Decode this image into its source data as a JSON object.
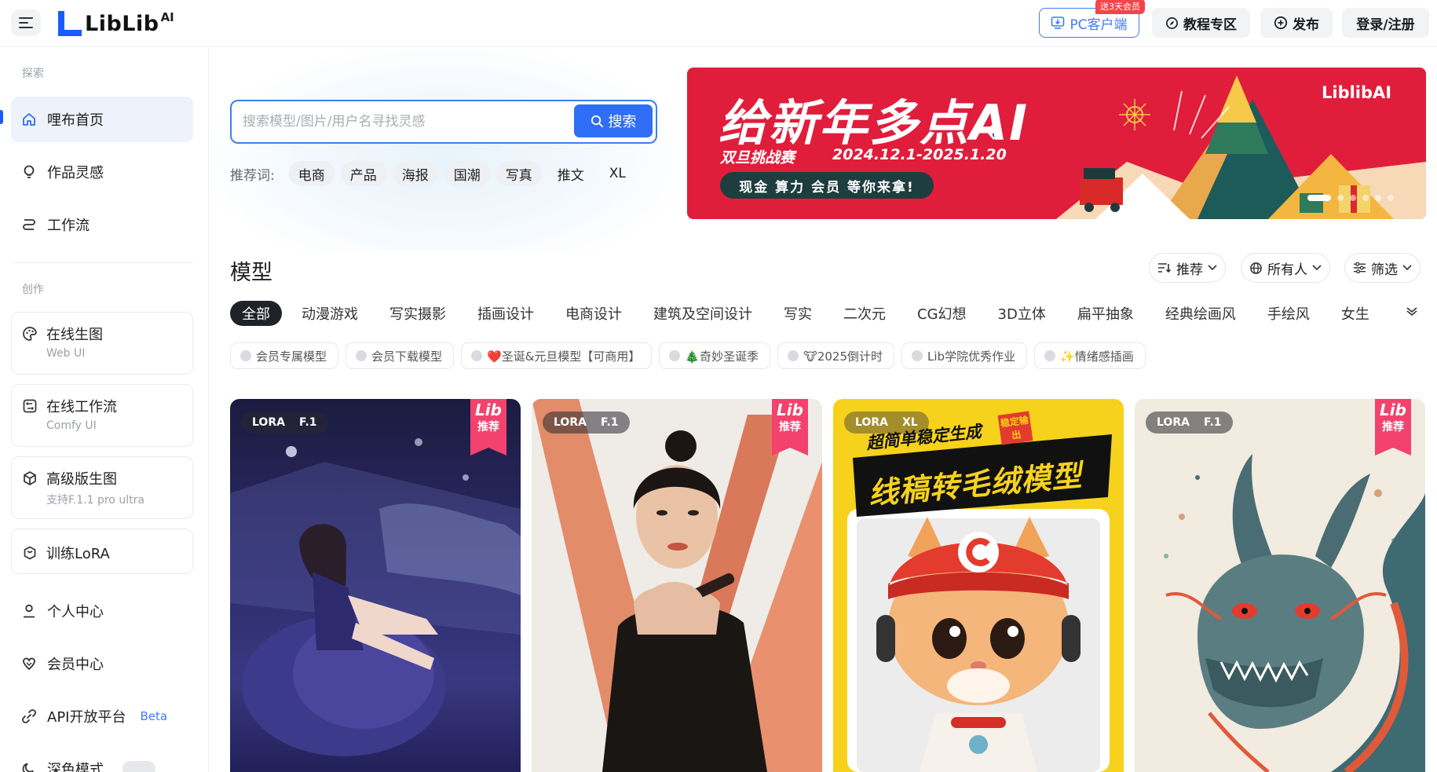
{
  "header": {
    "logo_text": "LiblibAI",
    "pc_client_label": "PC客户端",
    "pc_promo_tag": "送3天会员",
    "tutorial_label": "教程专区",
    "publish_label": "发布",
    "login_label": "登录/注册"
  },
  "sidebar": {
    "section_explore": "探索",
    "section_create": "创作",
    "items": [
      {
        "label": "哩布首页",
        "icon": "home-icon"
      },
      {
        "label": "作品灵感",
        "icon": "bulb-icon"
      },
      {
        "label": "工作流",
        "icon": "workflow-icon"
      }
    ],
    "create_items": [
      {
        "label": "在线生图",
        "sub": "Web UI",
        "icon": "palette-icon"
      },
      {
        "label": "在线工作流",
        "sub": "Comfy UI",
        "icon": "nodes-icon"
      },
      {
        "label": "高级版生图",
        "sub": "支持F.1.1 pro ultra",
        "icon": "cube-icon"
      },
      {
        "label": "训练LoRA",
        "sub": "",
        "icon": "box-icon"
      }
    ],
    "bottom_items": [
      {
        "label": "个人中心",
        "icon": "user-icon"
      },
      {
        "label": "会员中心",
        "icon": "diamond-icon"
      },
      {
        "label": "API开放平台",
        "badge": "Beta",
        "icon": "api-icon"
      },
      {
        "label": "深色模式",
        "icon": "moon-icon"
      }
    ]
  },
  "search": {
    "placeholder": "搜索模型/图片/用户名寻找灵感",
    "button_label": "搜索",
    "recommend_label": "推荐词:",
    "recommend_tags": [
      "电商",
      "产品",
      "海报",
      "国潮",
      "写真",
      "推文",
      "XL"
    ]
  },
  "banner": {
    "title": "给新年多点AI",
    "subtitle": "双旦挑战赛",
    "date": "2024.12.1-2025.1.20",
    "pill": "现金 算力 会员 等你来拿!",
    "logo": "LiblibAI"
  },
  "models": {
    "title": "模型",
    "sort_label": "推荐",
    "scope_label": "所有人",
    "filter_label": "筛选",
    "categories": [
      "全部",
      "动漫游戏",
      "写实摄影",
      "插画设计",
      "电商设计",
      "建筑及空间设计",
      "写实",
      "二次元",
      "CG幻想",
      "3D立体",
      "扁平抽象",
      "经典绘画风",
      "手绘风",
      "女生"
    ],
    "tags": [
      "会员专属模型",
      "会员下载模型",
      "❤️圣诞&元旦模型【可商用】",
      "🎄奇妙圣诞季",
      "🐮2025倒计时",
      "Lib学院优秀作业",
      "✨情绪感插画"
    ]
  },
  "cards": [
    {
      "type": "LORA",
      "base": "F.1",
      "ribbon_top": "Lib",
      "ribbon_bottom": "推荐"
    },
    {
      "type": "LORA",
      "base": "F.1",
      "ribbon_top": "Lib",
      "ribbon_bottom": "推荐"
    },
    {
      "type": "LORA",
      "base": "XL",
      "headline_small": "超简单稳定生成",
      "headline_big": "线稿转毛绒模型",
      "stamp": "稳定输出"
    },
    {
      "type": "LORA",
      "base": "F.1",
      "ribbon_top": "Lib",
      "ribbon_bottom": "推荐"
    }
  ],
  "colors": {
    "accent": "#2f6ef5",
    "banner_red": "#e11d3c",
    "ribbon_pink": "#f3426d"
  }
}
